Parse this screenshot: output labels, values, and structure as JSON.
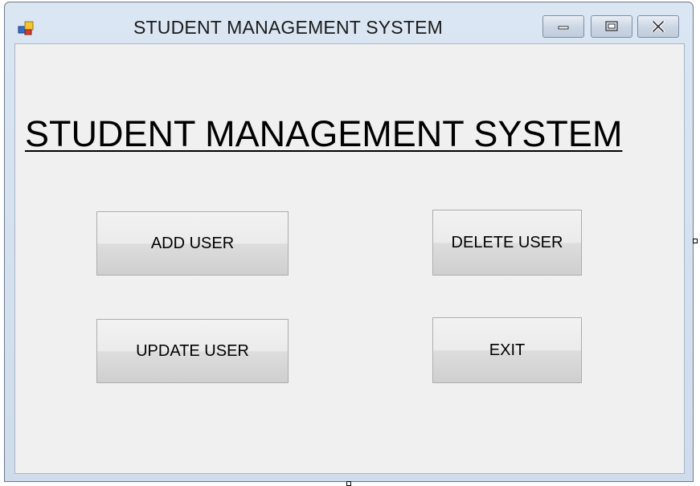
{
  "window": {
    "title": "STUDENT MANAGEMENT SYSTEM",
    "buttons": {
      "minimize": "minimize",
      "maximize": "maximize",
      "close": "close"
    }
  },
  "form": {
    "heading": "STUDENT MANAGEMENT SYSTEM",
    "buttons": {
      "add_user": "ADD USER",
      "delete_user": "DELETE USER",
      "update_user": "UPDATE USER",
      "exit": "EXIT"
    }
  },
  "icons": {
    "app": "app-form-icon",
    "minimize": "minimize-icon",
    "maximize": "maximize-icon",
    "close": "close-icon"
  },
  "colors": {
    "client_background": "#f0f0f0",
    "frame_border": "#6d7a89",
    "button_border": "#adadad"
  }
}
